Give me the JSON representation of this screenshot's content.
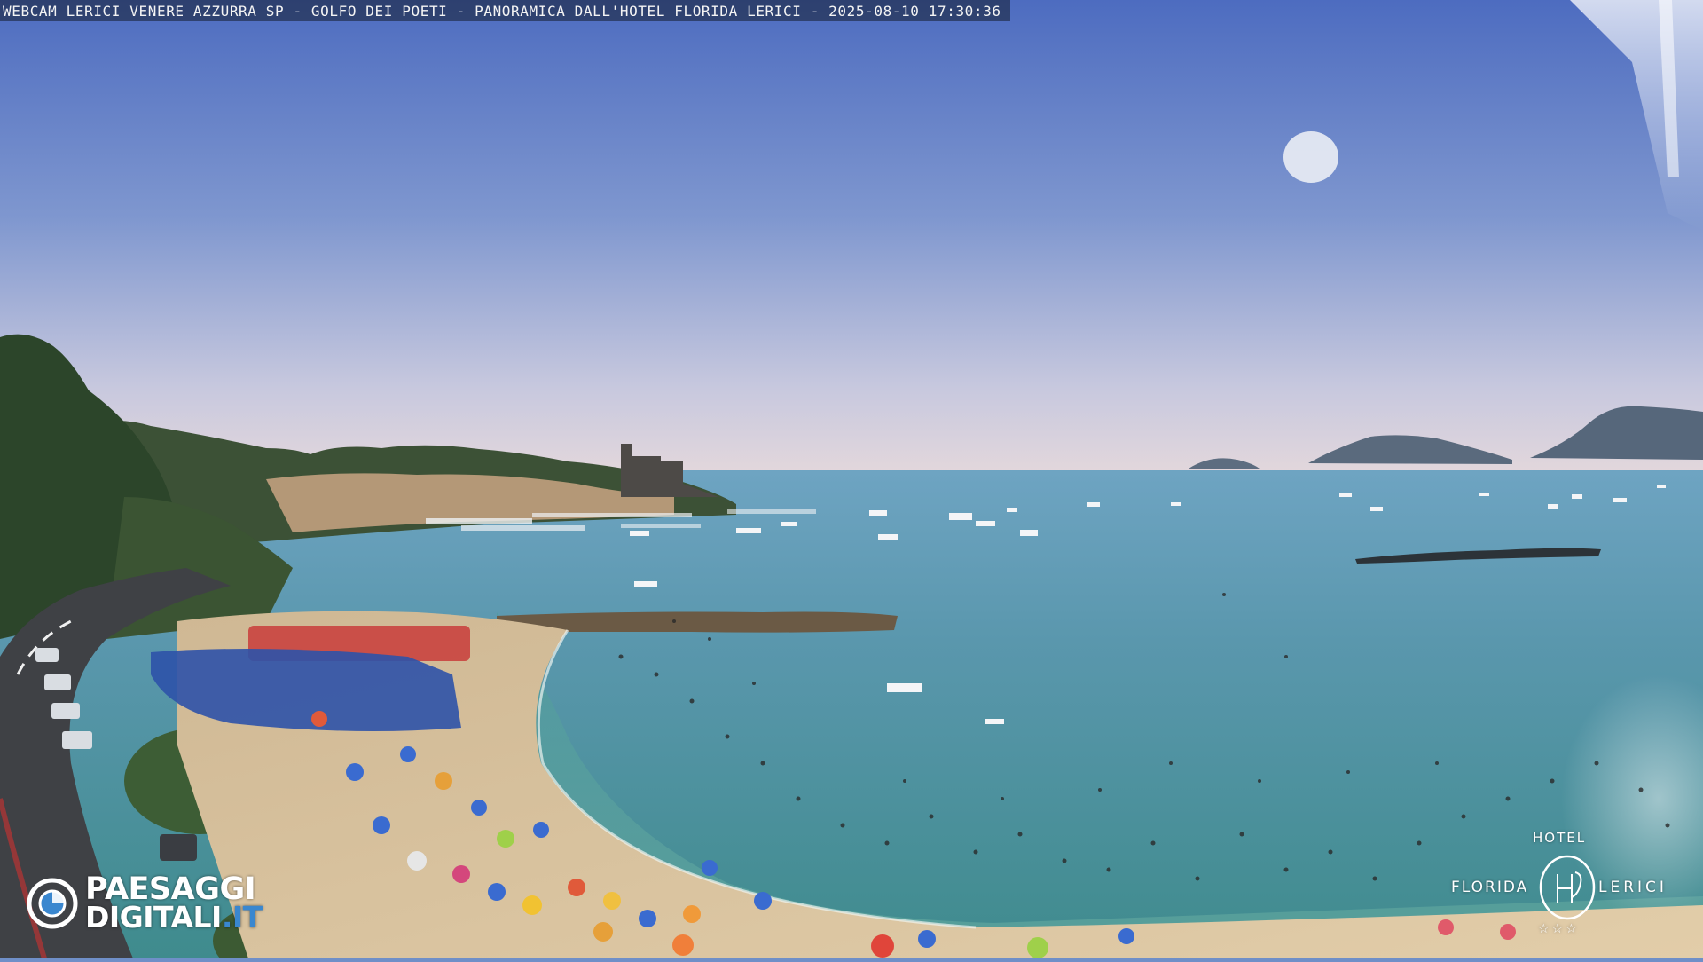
{
  "webcam": {
    "caption": "WEBCAM LERICI VENERE AZZURRA SP - GOLFO DEI POETI - PANORAMICA DALL'HOTEL FLORIDA LERICI - 2025-08-10 17:30:36"
  },
  "brand_logo": {
    "line1": "PAESAGGI",
    "line2": "DIGITALI",
    "line2_suffix": ".IT",
    "accent_color": "#3a87cf"
  },
  "hotel_logo": {
    "top": "HOTEL",
    "left": "FLORIDA",
    "right": "LERICI",
    "monogram": "HF",
    "stars": "☆☆☆"
  },
  "colors": {
    "sky_top": "#4f6fc1",
    "sky_horizon": "#e3d8dc",
    "sea_far": "#5f9fb9",
    "sea_near": "#3f8a93",
    "sand": "#dcc4a0",
    "vegetation": "#2f4a2b"
  }
}
